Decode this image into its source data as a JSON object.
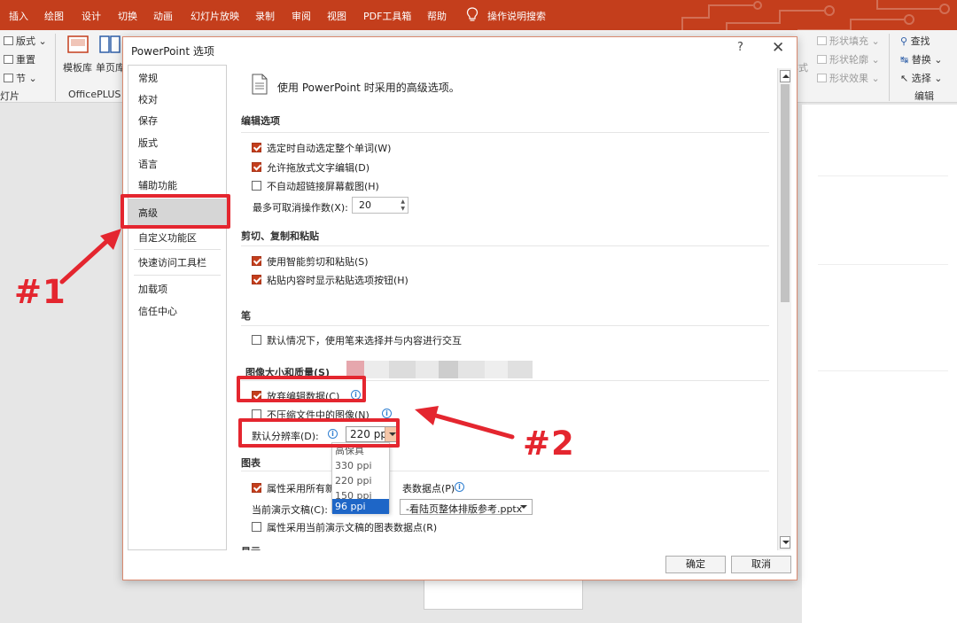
{
  "ribbon": {
    "tabs": [
      "插入",
      "绘图",
      "设计",
      "切换",
      "动画",
      "幻灯片放映",
      "录制",
      "审阅",
      "视图",
      "PDF工具箱",
      "帮助",
      "操作说明搜索"
    ],
    "left_group": {
      "layout": "版式",
      "reset": "重置",
      "section": "节",
      "group_label": "灯片"
    },
    "officeplus": {
      "template": "模板库",
      "single_page": "单页库",
      "group_label": "OfficePLUS"
    },
    "shape_tools": {
      "fill": "形状填充",
      "outline": "形状轮廓",
      "effect": "形状效果",
      "style": "样式"
    },
    "editing": {
      "find": "查找",
      "replace": "替换",
      "select": "选择",
      "group_label": "编辑"
    }
  },
  "dialog": {
    "title": "PowerPoint 选项",
    "help": "?",
    "close": "✕",
    "nav": [
      "常规",
      "校对",
      "保存",
      "版式",
      "语言",
      "辅助功能",
      "高级",
      "自定义功能区",
      "快速访问工具栏",
      "加载项",
      "信任中心"
    ],
    "selected_nav": "高级",
    "header": "使用 PowerPoint 时采用的高级选项。",
    "edit_section": {
      "title": "编辑选项",
      "opt1": "选定时自动选定整个单词(W)",
      "opt2": "允许拖放式文字编辑(D)",
      "opt3": "不自动超链接屏幕截图(H)",
      "undo_label": "最多可取消操作数(X):",
      "undo_value": "20"
    },
    "clipboard_section": {
      "title": "剪切、复制和粘贴",
      "opt1": "使用智能剪切和粘贴(S)",
      "opt2": "粘贴内容时显示粘贴选项按钮(H)"
    },
    "pen_section": {
      "title": "笔",
      "opt1": "默认情况下，使用笔来选择并与内容进行交互"
    },
    "image_section": {
      "title": "图像大小和质量(S)",
      "opt1": "放弃编辑数据(C)",
      "opt2": "不压缩文件中的图像(N)",
      "resolution_label": "默认分辨率(D):",
      "resolution_value": "220 ppi",
      "resolution_options": [
        "高保真",
        "330 ppi",
        "220 ppi",
        "150 ppi",
        "96 ppi"
      ],
      "highlighted_option": "96 ppi"
    },
    "chart_section": {
      "title": "图表",
      "opt1_prefix": "属性采用所有新",
      "opt1_suffix": "表数据点(P)",
      "current_doc_label": "当前演示文稿(C):",
      "current_doc_value": "-看陆页整体排版参考.pptx",
      "opt2": "属性采用当前演示文稿的图表数据点(R)"
    },
    "next_section_partial": "显示",
    "ok": "确定",
    "cancel": "取消"
  },
  "annotations": {
    "mark1": "#1",
    "mark2": "#2"
  },
  "colors": {
    "accent": "#c43e1c",
    "annotation": "#e4262f",
    "selection": "#1e66c7"
  }
}
